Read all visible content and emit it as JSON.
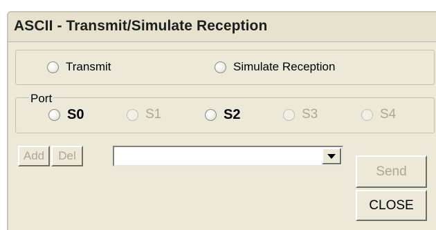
{
  "window": {
    "title": "ASCII - Transmit/Simulate Reception"
  },
  "mode": {
    "options": [
      {
        "label": "Transmit",
        "selected": false
      },
      {
        "label": "Simulate Reception",
        "selected": false
      }
    ]
  },
  "port": {
    "legend": "Port",
    "options": [
      {
        "label": "S0",
        "enabled": true,
        "selected": false
      },
      {
        "label": "S1",
        "enabled": false,
        "selected": false
      },
      {
        "label": "S2",
        "enabled": true,
        "selected": false
      },
      {
        "label": "S3",
        "enabled": false,
        "selected": false
      },
      {
        "label": "S4",
        "enabled": false,
        "selected": false
      }
    ]
  },
  "toolbar": {
    "add_label": "Add",
    "del_label": "Del",
    "message_value": ""
  },
  "actions": {
    "send_label": "Send",
    "close_label": "CLOSE"
  },
  "icons": {
    "combo_arrow": "chevron-down-icon",
    "radio": "radio-button-icon"
  },
  "colors": {
    "window_bg": "#ece9d8",
    "disabled_text": "#aca899",
    "group_border": "#c4c1ae"
  }
}
